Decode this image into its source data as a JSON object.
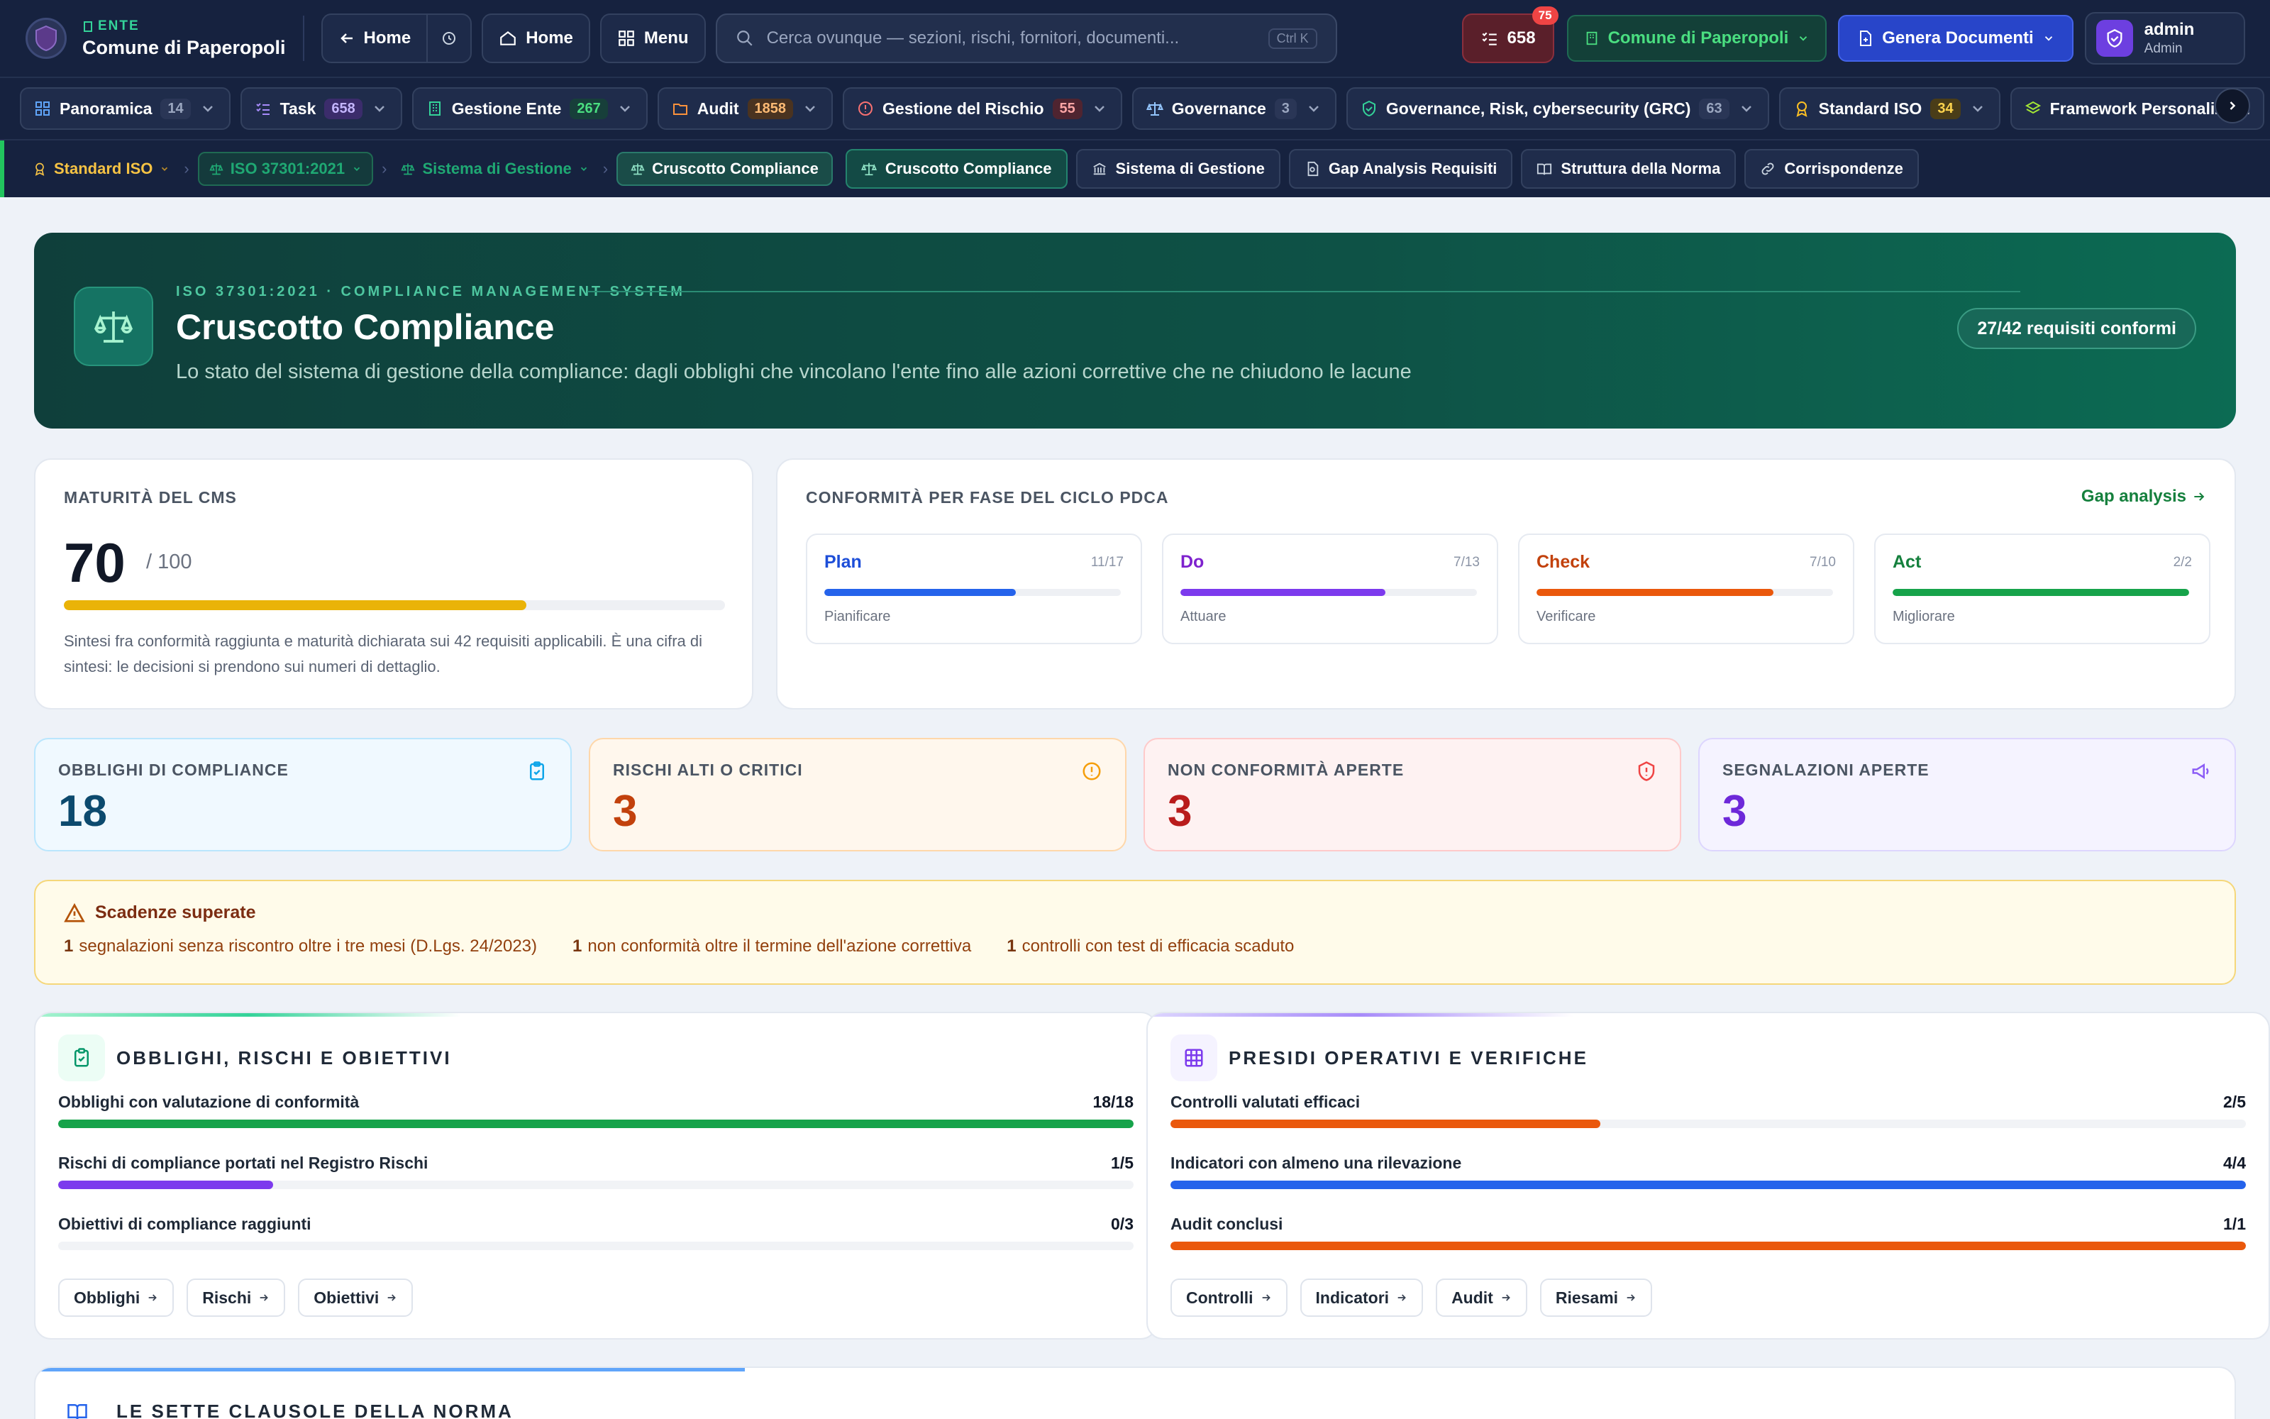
{
  "topbar": {
    "ente_tag": "ENTE",
    "ente_name": "Comune di Paperopoli",
    "home_back_label": "Home",
    "home_label": "Home",
    "menu_label": "Menu",
    "search_placeholder": "Cerca ovunque — sezioni, rischi, fornitori, documenti...",
    "search_shortcut": "Ctrl K",
    "tasks_count": "658",
    "tasks_badge": "75",
    "ente_select": "Comune di Paperopoli",
    "genera_label": "Genera Documenti",
    "user_name": "admin",
    "user_role": "Admin"
  },
  "modules": [
    {
      "label": "Panoramica",
      "count": "14",
      "icon": "grid-icon",
      "color": "#60a5fa",
      "count_bg": "#2a3656",
      "count_fg": "#9aa6bf"
    },
    {
      "label": "Task",
      "count": "658",
      "icon": "checklist-icon",
      "color": "#a78bfa",
      "count_bg": "#3b2c6b",
      "count_fg": "#c4b5fd"
    },
    {
      "label": "Gestione Ente",
      "count": "267",
      "icon": "building-icon",
      "color": "#34d399",
      "count_bg": "#173f3a",
      "count_fg": "#4ade80"
    },
    {
      "label": "Audit",
      "count": "1858",
      "icon": "folder-icon",
      "color": "#fb923c",
      "count_bg": "#4a3320",
      "count_fg": "#fdba74"
    },
    {
      "label": "Gestione del Rischio",
      "count": "55",
      "icon": "alert-circle-icon",
      "color": "#f87171",
      "count_bg": "#4f2430",
      "count_fg": "#fca5a5"
    },
    {
      "label": "Governance",
      "count": "3",
      "icon": "scale-icon",
      "color": "#93c5fd",
      "count_bg": "#2a3656",
      "count_fg": "#9aa6bf"
    },
    {
      "label": "Governance, Risk, cybersecurity (GRC)",
      "count": "63",
      "icon": "shield-check-icon",
      "color": "#34d399",
      "count_bg": "#2a3656",
      "count_fg": "#9aa6bf"
    },
    {
      "label": "Standard ISO",
      "count": "34",
      "icon": "award-icon",
      "color": "#fbbf24",
      "count_bg": "#4a3d18",
      "count_fg": "#fcd34d"
    },
    {
      "label": "Framework Personalizzati",
      "count": "",
      "icon": "layers-icon",
      "color": "#a3e635",
      "count_bg": "",
      "count_fg": ""
    }
  ],
  "subnav": {
    "crumb_standard": "Standard ISO",
    "crumb_iso": "ISO 37301:2021",
    "crumb_sistema": "Sistema di Gestione",
    "crumb_current": "Cruscotto Compliance",
    "tabs": [
      {
        "label": "Cruscotto Compliance",
        "icon": "scale-icon"
      },
      {
        "label": "Sistema di Gestione",
        "icon": "bank-icon"
      },
      {
        "label": "Gap Analysis Requisiti",
        "icon": "document-search-icon"
      },
      {
        "label": "Struttura della Norma",
        "icon": "book-open-icon"
      },
      {
        "label": "Corrispondenze",
        "icon": "link-icon"
      }
    ]
  },
  "hero": {
    "kicker": "ISO 37301:2021 · COMPLIANCE MANAGEMENT SYSTEM",
    "title": "Cruscotto Compliance",
    "subtitle": "Lo stato del sistema di gestione della compliance: dagli obblighi che vincolano l'ente fino alle azioni correttive che ne chiudono le lacune",
    "pill": "27/42 requisiti conformi"
  },
  "maturity": {
    "label": "MATURITÀ DEL CMS",
    "value": "70",
    "of": "/ 100",
    "progress": 0.7,
    "color": "#eab308",
    "note": "Sintesi fra conformità raggiunta e maturità dichiarata sui 42 requisiti applicabili. È una cifra di sintesi: le decisioni si prendono sui numeri di dettaglio."
  },
  "pdca": {
    "label": "CONFORMITÀ PER FASE DEL CICLO PDCA",
    "link": "Gap analysis",
    "phases": [
      {
        "name": "Plan",
        "ratio": "11/17",
        "desc": "Pianificare",
        "color": "#1d4ed8",
        "bar": "#2563eb",
        "progress": 0.647
      },
      {
        "name": "Do",
        "ratio": "7/13",
        "desc": "Attuare",
        "color": "#7e22ce",
        "bar": "#7c3aed",
        "progress": 0.692
      },
      {
        "name": "Check",
        "ratio": "7/10",
        "desc": "Verificare",
        "color": "#c2410c",
        "bar": "#ea580c",
        "progress": 0.8
      },
      {
        "name": "Act",
        "ratio": "2/2",
        "desc": "Migliorare",
        "color": "#15803d",
        "bar": "#16a34a",
        "progress": 1.0
      }
    ]
  },
  "stats": [
    {
      "label": "OBBLIGHI DI COMPLIANCE",
      "value": "18",
      "icon": "clipboard-check-icon",
      "bg": "#f0f9ff",
      "border": "#bae6fd",
      "fg": "#0c4a6e",
      "icon_color": "#0ea5e9"
    },
    {
      "label": "RISCHI ALTI O CRITICI",
      "value": "3",
      "icon": "alert-circle-icon",
      "bg": "#fff7ed",
      "border": "#fed7aa",
      "fg": "#c2410c",
      "icon_color": "#f59e0b"
    },
    {
      "label": "NON CONFORMITÀ APERTE",
      "value": "3",
      "icon": "shield-alert-icon",
      "bg": "#fef2f2",
      "border": "#fecaca",
      "fg": "#b91c1c",
      "icon_color": "#ef4444"
    },
    {
      "label": "SEGNALAZIONI APERTE",
      "value": "3",
      "icon": "megaphone-icon",
      "bg": "#f5f3ff",
      "border": "#ddd6fe",
      "fg": "#6d28d9",
      "icon_color": "#8b5cf6"
    }
  ],
  "alert": {
    "title": "Scadenze superate",
    "items": [
      {
        "count": "1",
        "text": "segnalazioni senza riscontro oltre i tre mesi (D.Lgs. 24/2023)"
      },
      {
        "count": "1",
        "text": "non conformità oltre il termine dell'azione correttiva"
      },
      {
        "count": "1",
        "text": "controlli con test di efficacia scaduto"
      }
    ]
  },
  "obblighi_card": {
    "title": "OBBLIGHI, RISCHI E OBIETTIVI",
    "rows": [
      {
        "label": "Obblighi con valutazione di conformità",
        "value": "18/18",
        "progress": 1.0,
        "color": "#16a34a"
      },
      {
        "label": "Rischi di compliance portati nel Registro Rischi",
        "value": "1/5",
        "progress": 0.2,
        "color": "#7c3aed"
      },
      {
        "label": "Obiettivi di compliance raggiunti",
        "value": "0/3",
        "progress": 0.0,
        "color": "#16a34a"
      }
    ],
    "chips": [
      "Obblighi",
      "Rischi",
      "Obiettivi"
    ]
  },
  "presidi_card": {
    "title": "PRESIDI OPERATIVI E VERIFICHE",
    "rows": [
      {
        "label": "Controlli valutati efficaci",
        "value": "2/5",
        "progress": 0.4,
        "color": "#ea580c"
      },
      {
        "label": "Indicatori con almeno una rilevazione",
        "value": "4/4",
        "progress": 1.0,
        "color": "#2563eb"
      },
      {
        "label": "Audit conclusi",
        "value": "1/1",
        "progress": 1.0,
        "color": "#ea580c"
      }
    ],
    "chips": [
      "Controlli",
      "Indicatori",
      "Audit",
      "Riesami"
    ]
  },
  "clauses": {
    "title": "LE SETTE CLAUSOLE DELLA NORMA"
  }
}
